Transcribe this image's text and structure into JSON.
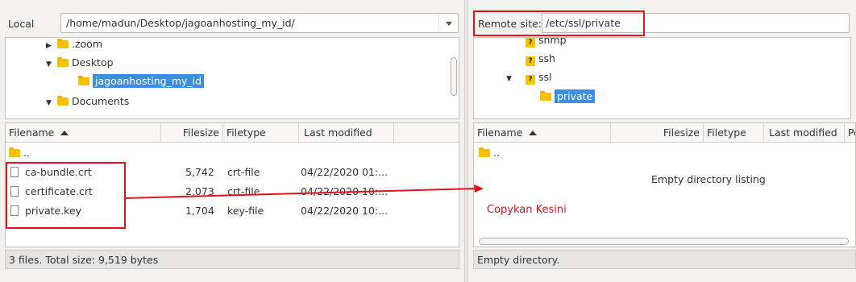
{
  "local": {
    "label": "Local",
    "path": "/home/madun/Desktop/jagoanhosting_my_id/",
    "tree": [
      {
        "label": ".zoom",
        "expanded": false
      },
      {
        "label": "Desktop",
        "expanded": true
      },
      {
        "label": "jagoanhosting_my_id",
        "selected": true
      },
      {
        "label": "Documents",
        "expanded": true
      }
    ],
    "columns": [
      "Filename",
      "Filesize",
      "Filetype",
      "Last modified"
    ],
    "parent": "..",
    "files": [
      {
        "name": "ca-bundle.crt",
        "size": "5,742",
        "type": "crt-file",
        "modified": "04/22/2020 01:..."
      },
      {
        "name": "certificate.crt",
        "size": "2,073",
        "type": "crt-file",
        "modified": "04/22/2020 10:..."
      },
      {
        "name": "private.key",
        "size": "1,704",
        "type": "key-file",
        "modified": "04/22/2020 10:..."
      }
    ],
    "status": "3 files. Total size: 9,519 bytes"
  },
  "remote": {
    "label": "Remote site:",
    "path": "/etc/ssl/private",
    "tree": [
      {
        "label": "snmp",
        "icon": "question-folder-icon"
      },
      {
        "label": "ssh",
        "icon": "question-folder-icon"
      },
      {
        "label": "ssl",
        "icon": "question-folder-icon",
        "expanded": true
      },
      {
        "label": "private",
        "selected": true
      }
    ],
    "columns": [
      "Filename",
      "Filesize",
      "Filetype",
      "Last modified",
      "Pe"
    ],
    "parent": "..",
    "empty_listing": "Empty directory listing",
    "status": "Empty directory."
  },
  "annotation": {
    "text": "Copykan Kesini",
    "color": "#e0141a"
  },
  "colors": {
    "selection": "#3d8ee0",
    "folder": "#f7c100",
    "highlight": "#e0141a"
  }
}
